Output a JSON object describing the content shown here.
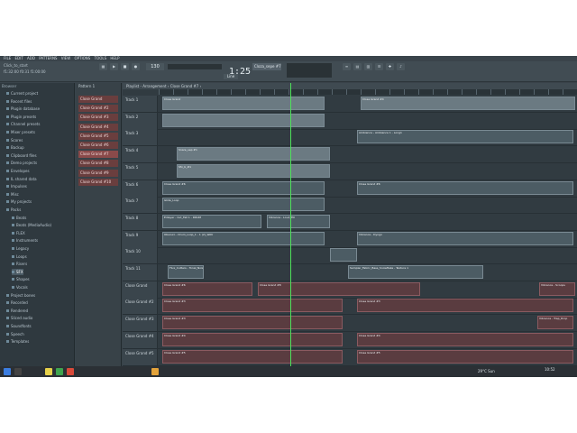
{
  "menu": [
    "FILE",
    "EDIT",
    "ADD",
    "PATTERNS",
    "VIEW",
    "OPTIONS",
    "TOOLS",
    "HELP"
  ],
  "toolbar": {
    "tempo_display": "1:25",
    "pattern_name": "Cloza_sepe #7",
    "hint_line1": "Click_to_start",
    "hint_line2": "f1:32:00 f0:31 f1:00:00",
    "mode_badge": "Line"
  },
  "browser": {
    "header": "Browser",
    "items": [
      {
        "label": "Current project",
        "sub": false,
        "sel": false
      },
      {
        "label": "Recent files",
        "sub": false,
        "sel": false
      },
      {
        "label": "Plugin database",
        "sub": false,
        "sel": false
      },
      {
        "label": "Plugin presets",
        "sub": false,
        "sel": false
      },
      {
        "label": "Channel presets",
        "sub": false,
        "sel": false
      },
      {
        "label": "Mixer presets",
        "sub": false,
        "sel": false
      },
      {
        "label": "Scores",
        "sub": false,
        "sel": false
      },
      {
        "label": "Backup",
        "sub": false,
        "sel": false
      },
      {
        "label": "Clipboard files",
        "sub": false,
        "sel": false
      },
      {
        "label": "Demo projects",
        "sub": false,
        "sel": false
      },
      {
        "label": "Envelopes",
        "sub": false,
        "sel": false
      },
      {
        "label": "IL shared data",
        "sub": false,
        "sel": false
      },
      {
        "label": "Impulses",
        "sub": false,
        "sel": false
      },
      {
        "label": "Misc",
        "sub": false,
        "sel": false
      },
      {
        "label": "My projects",
        "sub": false,
        "sel": false
      },
      {
        "label": "Packs",
        "sub": false,
        "sel": false
      },
      {
        "label": "Beats",
        "sub": true,
        "sel": false
      },
      {
        "label": "Beats (MediaAudio)",
        "sub": true,
        "sel": false
      },
      {
        "label": "FLEX",
        "sub": true,
        "sel": false
      },
      {
        "label": "Instruments",
        "sub": true,
        "sel": false
      },
      {
        "label": "Legacy",
        "sub": true,
        "sel": false
      },
      {
        "label": "Loops",
        "sub": true,
        "sel": false
      },
      {
        "label": "Risers",
        "sub": true,
        "sel": false
      },
      {
        "label": "SFX",
        "sub": true,
        "sel": true
      },
      {
        "label": "Shapes",
        "sub": true,
        "sel": false
      },
      {
        "label": "Vocals",
        "sub": true,
        "sel": false
      },
      {
        "label": "Project bones",
        "sub": false,
        "sel": false
      },
      {
        "label": "Recorded",
        "sub": false,
        "sel": false
      },
      {
        "label": "Rendered",
        "sub": false,
        "sel": false
      },
      {
        "label": "Sliced audio",
        "sub": false,
        "sel": false
      },
      {
        "label": "Soundfonts",
        "sub": false,
        "sel": false
      },
      {
        "label": "Speech",
        "sub": false,
        "sel": false
      },
      {
        "label": "Templates",
        "sub": false,
        "sel": false
      }
    ]
  },
  "channelrack": {
    "header": "Pattern 1",
    "patterns": [
      "Close Grand",
      "Close Grand #2",
      "Close Grand #3",
      "Close Grand #4",
      "Close Grand #5",
      "Close Grand #6",
      "Close Grand #7",
      "Close Grand #8",
      "Close Grand #9",
      "Close Grand #10"
    ],
    "selected_index": 6
  },
  "playlist": {
    "title": "Playlist - Arrangement › Close Grand #7 ›",
    "tracks": [
      {
        "name": "Track 1",
        "clips": [
          {
            "label": "Close Grand",
            "type": "pat"
          },
          {
            "label": "Close Grand #4",
            "type": "pat"
          }
        ]
      },
      {
        "name": "Track 2",
        "clips": [
          {
            "label": "",
            "type": "pat"
          }
        ]
      },
      {
        "name": "Track 3",
        "clips": [
          {
            "label": "Ambience - Ambience 1 - Long1",
            "type": "audio"
          }
        ]
      },
      {
        "name": "Track 4",
        "clips": [
          {
            "label": "Snare_sep #1",
            "type": "pat"
          }
        ]
      },
      {
        "name": "Track 5",
        "clips": [
          {
            "label": "Sfx_b_#1",
            "type": "pat"
          }
        ]
      },
      {
        "name": "Track 6",
        "clips": [
          {
            "label": "Close Grand #6",
            "type": "audio"
          },
          {
            "label": "Close Grand #6",
            "type": "audio"
          }
        ]
      },
      {
        "name": "Track 7",
        "clips": [
          {
            "label": "Glide_Loop",
            "type": "audio"
          }
        ]
      },
      {
        "name": "Track 8",
        "clips": [
          {
            "label": "Edlayer - Cut_Fall 1 - DRUM",
            "type": "audio"
          },
          {
            "label": "Vibrance - Loud_Fill",
            "type": "audio"
          }
        ]
      },
      {
        "name": "Track 9",
        "clips": [
          {
            "label": "Obscuro - Drum_Loop_1 - 1 (2)_WAV",
            "type": "audio"
          },
          {
            "label": "Vibrance - Dyngo",
            "type": "audio"
          }
        ]
      },
      {
        "name": "Track 10",
        "clips": [
          {
            "label": "",
            "type": "audio"
          }
        ]
      },
      {
        "name": "Track 11",
        "clips": [
          {
            "label": "Flux_Cutters - Tonal_Noise",
            "type": "audio"
          },
          {
            "label": "Sampler_Fabric_Bass_Snowflake - Texture 1",
            "type": "audio"
          }
        ]
      },
      {
        "name": "Close Grand",
        "clips": [
          {
            "label": "Close Grand #6",
            "type": "red"
          },
          {
            "label": "Close Grand #8",
            "type": "red"
          },
          {
            "label": "Vibrance - Scoops",
            "type": "red"
          }
        ]
      },
      {
        "name": "Close Grand #2",
        "clips": [
          {
            "label": "Close Grand #3",
            "type": "red"
          },
          {
            "label": "Close Grand #3",
            "type": "red"
          }
        ]
      },
      {
        "name": "Close Grand #3",
        "clips": [
          {
            "label": "Close Grand #3",
            "type": "red"
          },
          {
            "label": "Vibrance - Trap_Drop",
            "type": "red"
          }
        ]
      },
      {
        "name": "Close Grand #4",
        "clips": [
          {
            "label": "Close Grand #4",
            "type": "red"
          },
          {
            "label": "Close Grand #4",
            "type": "red"
          }
        ]
      },
      {
        "name": "Close Grand #5",
        "clips": [
          {
            "label": "Close Grand #5",
            "type": "red"
          },
          {
            "label": "Close Grand #5",
            "type": "red"
          }
        ]
      }
    ]
  },
  "taskbar": {
    "time": "10:52",
    "date": "",
    "weather": "29°C Sun"
  }
}
